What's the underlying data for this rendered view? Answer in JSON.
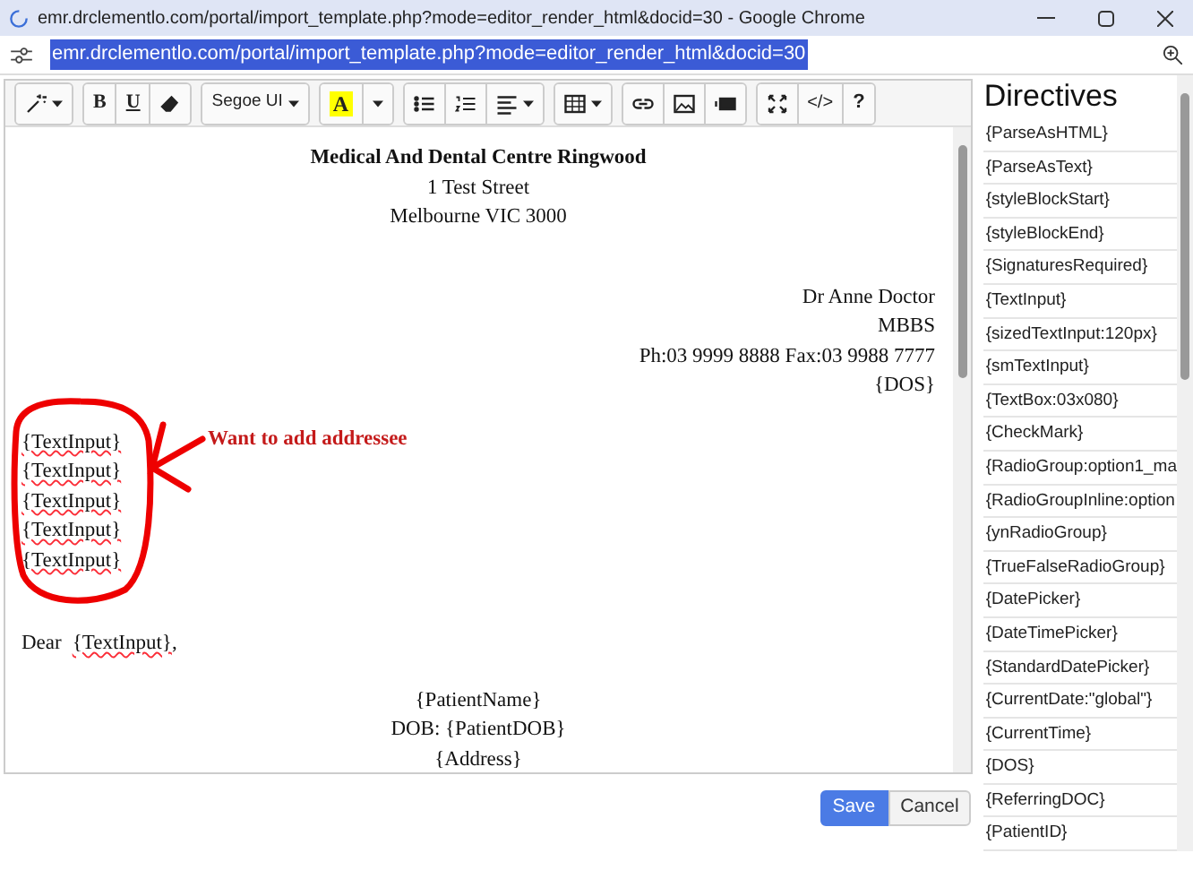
{
  "window": {
    "title": "emr.drclementlo.com/portal/import_template.php?mode=editor_render_html&docid=30 - Google Chrome"
  },
  "address_bar": {
    "url": "emr.drclementlo.com/portal/import_template.php?mode=editor_render_html&docid=30",
    "selected": true
  },
  "toolbar": {
    "bold": "B",
    "underline": "U",
    "font": "Segoe UI",
    "highlight": "A",
    "code": "</>",
    "help": "?"
  },
  "letter": {
    "header": [
      {
        "text": "Medical And Dental Centre Ringwood",
        "bold": true
      },
      {
        "text": "1 Test Street",
        "bold": false
      },
      {
        "text": "Melbourne VIC 3000",
        "bold": false
      }
    ],
    "doctor": [
      "Dr Anne Doctor",
      "MBBS",
      "Ph:03 9999 8888 Fax:03 9988 7777",
      "{DOS}"
    ],
    "addressee": [
      "{TextInput}",
      "{TextInput}",
      "{TextInput}",
      "{TextInput}",
      "{TextInput}"
    ],
    "salutation": {
      "word": "Dear",
      "field": "{TextInput}",
      "punct": ","
    },
    "patient": [
      "{PatientName}",
      "DOB: {PatientDOB}",
      "{Address}"
    ]
  },
  "annotation": {
    "text": "Want to add addressee"
  },
  "buttons": [
    {
      "label": "Save",
      "primary": true
    },
    {
      "label": "Cancel",
      "primary": false
    }
  ],
  "directives": {
    "title": "Directives",
    "items": [
      "{ParseAsHTML}",
      "{ParseAsText}",
      "{styleBlockStart}",
      "{styleBlockEnd}",
      "{SignaturesRequired}",
      "{TextInput}",
      "{sizedTextInput:120px}",
      "{smTextInput}",
      "{TextBox:03x080}",
      "{CheckMark}",
      "{RadioGroup:option1_ma",
      "{RadioGroupInline:option",
      "{ynRadioGroup}",
      "{TrueFalseRadioGroup}",
      "{DatePicker}",
      "{DateTimePicker}",
      "{StandardDatePicker}",
      "{CurrentDate:\"global\"}",
      "{CurrentTime}",
      "{DOS}",
      "{ReferringDOC}",
      "{PatientID}"
    ]
  }
}
